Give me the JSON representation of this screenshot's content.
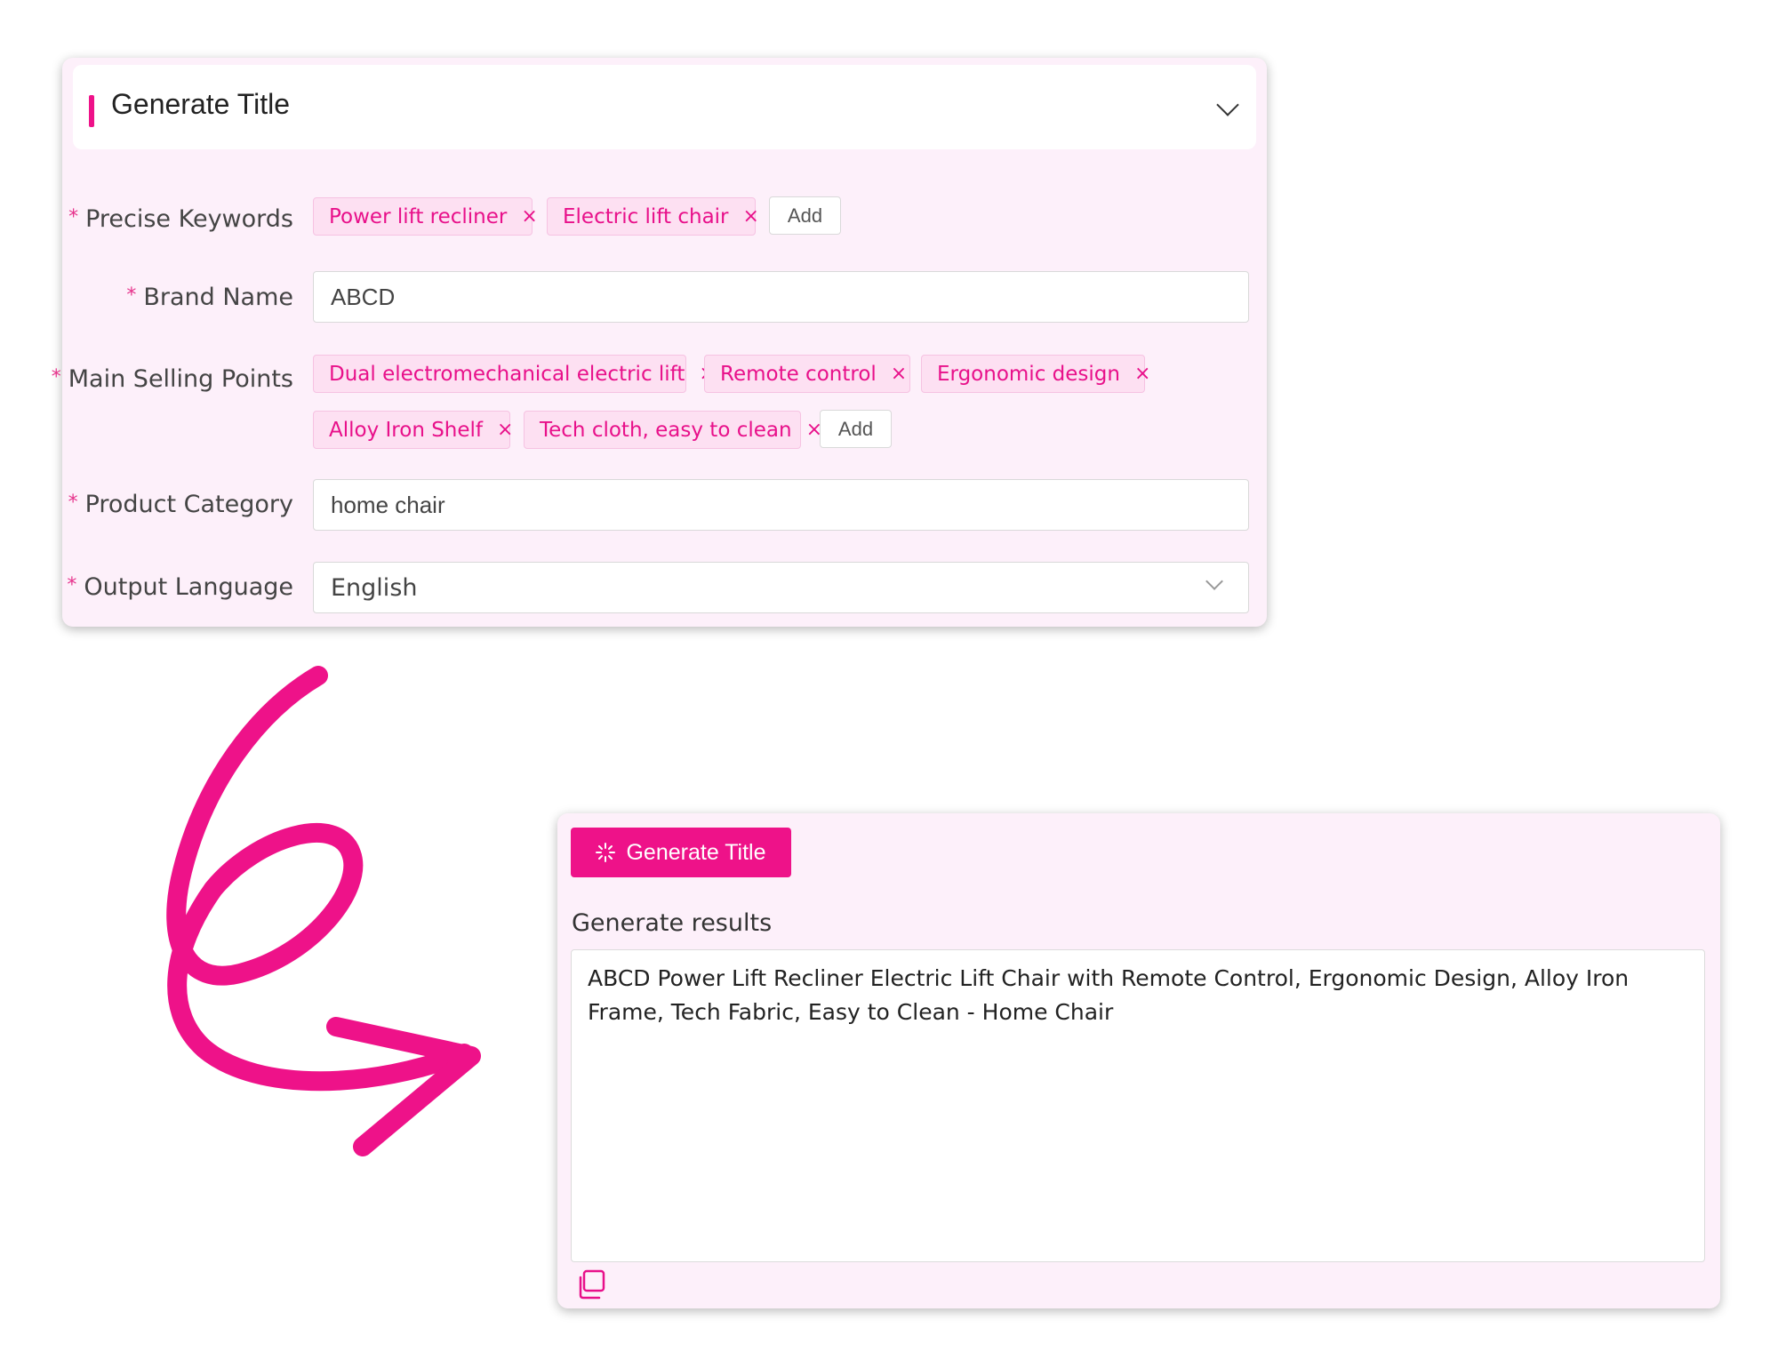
{
  "form": {
    "title": "Generate Title",
    "required_mark": "*",
    "precise_keywords": {
      "label": "Precise Keywords",
      "tags": [
        "Power lift recliner",
        "Electric lift chair"
      ],
      "add_label": "Add"
    },
    "brand_name": {
      "label": "Brand Name",
      "value": "ABCD"
    },
    "main_selling_points": {
      "label": "Main Selling Points",
      "tags": [
        "Dual electromechanical electric lift",
        "Remote control",
        "Ergonomic design",
        "Alloy Iron Shelf",
        "Tech cloth, easy to clean"
      ],
      "add_label": "Add"
    },
    "product_category": {
      "label": "Product Category",
      "value": "home chair"
    },
    "output_language": {
      "label": "Output Language",
      "value": "English"
    },
    "tag_close_glyph": "×"
  },
  "result": {
    "button_label": "Generate Title",
    "results_label": "Generate results",
    "text": "ABCD Power Lift Recliner Electric Lift Chair with Remote Control, Ergonomic Design, Alloy Iron Frame, Tech Fabric, Easy to Clean - Home Chair"
  },
  "colors": {
    "accent": "#ee1289",
    "panel_bg": "#fdf0fa",
    "tag_bg": "#fde0f2"
  },
  "icons": [
    "chevron-down-icon",
    "close-icon",
    "sparkle-icon",
    "copy-icon",
    "arrow-doodle"
  ]
}
